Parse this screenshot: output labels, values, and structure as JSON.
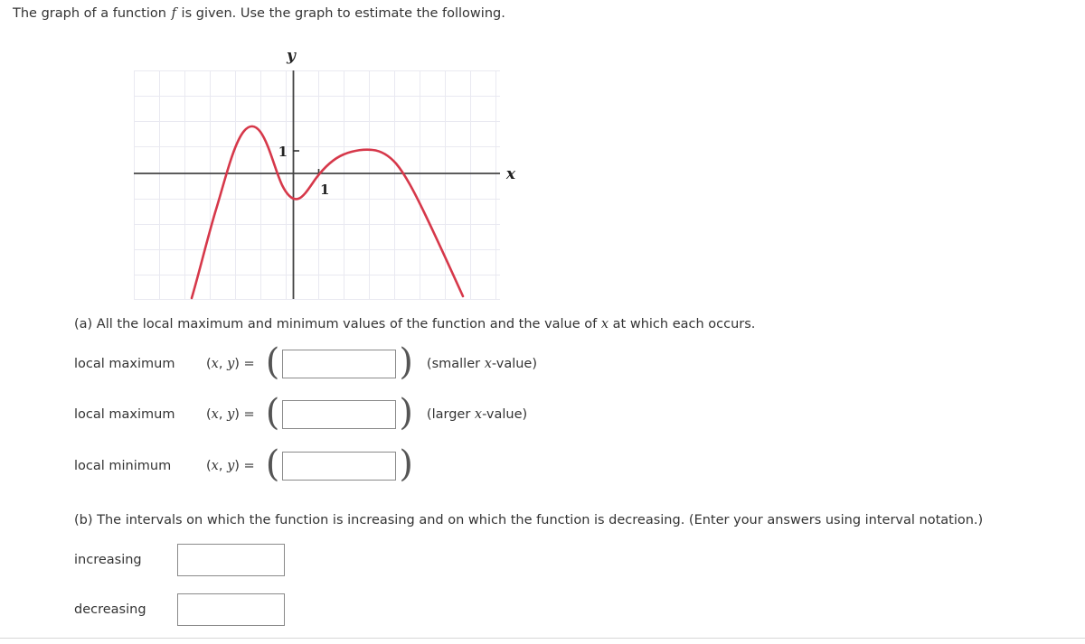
{
  "prompt": {
    "before": "The graph of a function",
    "function_symbol": "f",
    "after": "is given. Use the graph to estimate the following."
  },
  "graph": {
    "axis_labels": {
      "x": "x",
      "y": "y"
    },
    "tick_labels": {
      "y_one": "1",
      "x_one": "1"
    },
    "curve_color": "#d6384a",
    "grid_color": "#e8e8ef",
    "axis_color": "#444444"
  },
  "chart_data": {
    "type": "line",
    "title": "",
    "xlabel": "x",
    "ylabel": "y",
    "grid": true,
    "legend": null,
    "xlim": [
      -6.3,
      8.2
    ],
    "ylim": [
      -5.5,
      4.1
    ],
    "xticks": [
      1
    ],
    "yticks": [
      1
    ],
    "series": [
      {
        "name": "f",
        "comment": "cubic-like curve with two local maxima and one local minimum",
        "points": [
          [
            -4.0,
            -5.4
          ],
          [
            -3.6,
            -3.9
          ],
          [
            -3.2,
            -2.3
          ],
          [
            -2.8,
            -0.8
          ],
          [
            -2.4,
            0.6
          ],
          [
            -2.0,
            1.45
          ],
          [
            -1.6,
            1.9
          ],
          [
            -1.3,
            2.0
          ],
          [
            -1.0,
            1.8
          ],
          [
            -0.6,
            1.1
          ],
          [
            -0.3,
            0.4
          ],
          [
            0.0,
            -0.3
          ],
          [
            0.3,
            -0.75
          ],
          [
            0.6,
            -0.85
          ],
          [
            0.9,
            -0.7
          ],
          [
            1.2,
            -0.3
          ],
          [
            1.5,
            0.1
          ],
          [
            2.0,
            0.65
          ],
          [
            2.6,
            1.0
          ],
          [
            3.2,
            1.15
          ],
          [
            3.6,
            1.1
          ],
          [
            4.2,
            0.85
          ],
          [
            4.8,
            0.45
          ],
          [
            5.4,
            -0.1
          ],
          [
            6.0,
            -0.9
          ],
          [
            6.6,
            -2.0
          ],
          [
            7.2,
            -3.3
          ],
          [
            7.6,
            -4.3
          ],
          [
            7.9,
            -5.3
          ]
        ],
        "local_maxima": [
          [
            -1.3,
            2.0
          ],
          [
            3.2,
            1.15
          ]
        ],
        "local_minima": [
          [
            0.6,
            -0.85
          ]
        ]
      }
    ]
  },
  "part_a": {
    "question": "(a) All the local maximum and minimum values of the function and the value of x at which each occurs.",
    "question_prefix": "(a) All the local maximum and minimum values of the function and the value of",
    "question_var": "x",
    "question_suffix": "at which each occurs.",
    "rows": [
      {
        "label": "local maximum",
        "eq_prefix": "(",
        "eq_x": "x",
        "eq_comma": ", ",
        "eq_y": "y",
        "eq_suffix": ") =",
        "value": "",
        "placeholder": "",
        "note_prefix": "(smaller ",
        "note_var": "x",
        "note_suffix": "-value)"
      },
      {
        "label": "local maximum",
        "eq_prefix": "(",
        "eq_x": "x",
        "eq_comma": ", ",
        "eq_y": "y",
        "eq_suffix": ") =",
        "value": "",
        "placeholder": "",
        "note_prefix": "(larger ",
        "note_var": "x",
        "note_suffix": "-value)"
      },
      {
        "label": "local minimum",
        "eq_prefix": "(",
        "eq_x": "x",
        "eq_comma": ", ",
        "eq_y": "y",
        "eq_suffix": ") =",
        "value": "",
        "placeholder": "",
        "note_prefix": "",
        "note_var": "",
        "note_suffix": ""
      }
    ]
  },
  "part_b": {
    "question": "(b) The intervals on which the function is increasing and on which the function is decreasing. (Enter your answers using interval notation.)",
    "rows": [
      {
        "label": "increasing",
        "value": "",
        "placeholder": ""
      },
      {
        "label": "decreasing",
        "value": "",
        "placeholder": ""
      }
    ]
  }
}
